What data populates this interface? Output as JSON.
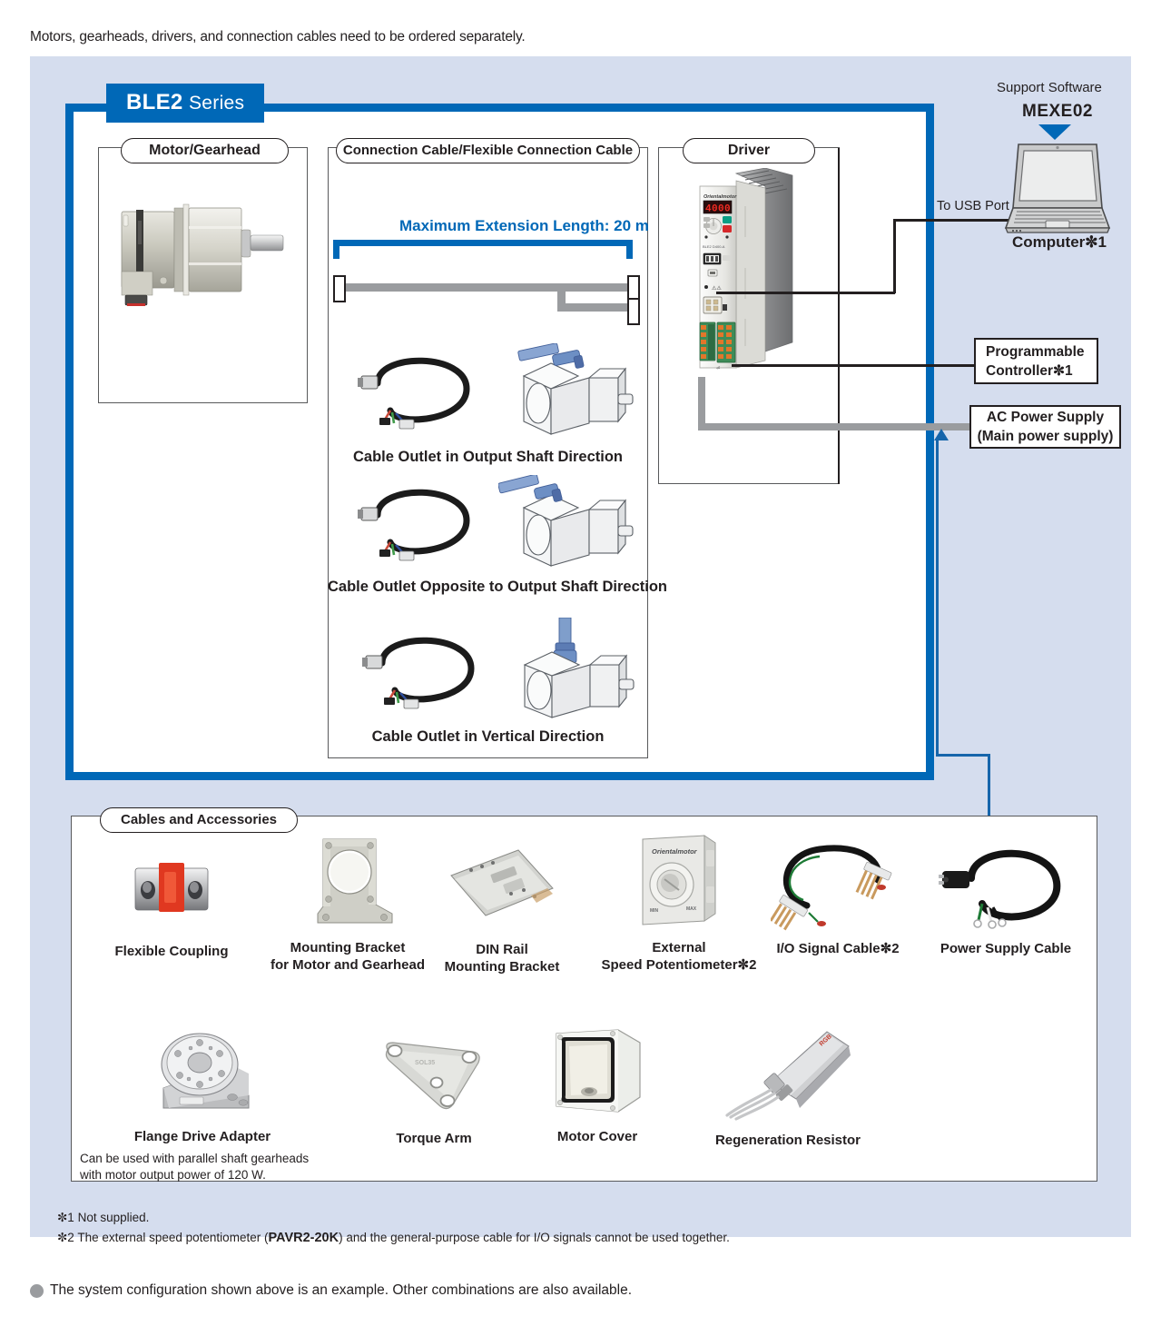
{
  "intro": "Motors, gearheads, drivers, and connection cables need to be ordered separately.",
  "series": {
    "name": "BLE2",
    "suffix": "Series"
  },
  "colors": {
    "brand_blue": "#0068B7",
    "panel_bg": "#D5DDEE",
    "cable_grey": "#9A9C9F",
    "text": "#231F20"
  },
  "sections": {
    "motor": {
      "title": "Motor/Gearhead"
    },
    "cable": {
      "title": "Connection Cable/Flexible Connection Cable",
      "max_extension": "Maximum Extension Length: 20 m",
      "variants": [
        {
          "caption": "Cable Outlet in Output Shaft Direction"
        },
        {
          "caption": "Cable Outlet Opposite to Output Shaft Direction"
        },
        {
          "caption": "Cable Outlet in Vertical Direction"
        }
      ]
    },
    "driver": {
      "title": "Driver",
      "display_value": "4000"
    }
  },
  "support": {
    "label": "Support Software",
    "product": "MEXE02",
    "computer": "Computer✼1",
    "usb_port": "To USB Port"
  },
  "side_boxes": {
    "plc_line1": "Programmable",
    "plc_line2": "Controller✼1",
    "ac_line1": "AC Power Supply",
    "ac_line2": "(Main power supply)"
  },
  "accessories": {
    "title": "Cables and Accessories",
    "row1": [
      {
        "label": "Flexible Coupling",
        "icon": "flexible-coupling"
      },
      {
        "label_line1": "Mounting Bracket",
        "label_line2": "for Motor and Gearhead",
        "icon": "mounting-bracket"
      },
      {
        "label_line1": "DIN Rail",
        "label_line2": "Mounting Bracket",
        "icon": "din-rail-bracket"
      },
      {
        "label_line1": "External",
        "label_line2": "Speed Potentiometer✼2",
        "icon": "speed-potentiometer"
      },
      {
        "label": "I/O Signal Cable✼2",
        "icon": "io-signal-cable"
      },
      {
        "label": "Power Supply Cable",
        "icon": "power-supply-cable"
      }
    ],
    "row2": [
      {
        "label": "Flange Drive Adapter",
        "note_line1": "Can be used with parallel shaft gearheads",
        "note_line2": "with motor output power of 120 W.",
        "icon": "flange-drive-adapter"
      },
      {
        "label": "Torque Arm",
        "icon": "torque-arm"
      },
      {
        "label": "Motor Cover",
        "icon": "motor-cover"
      },
      {
        "label": "Regeneration Resistor",
        "icon": "regeneration-resistor"
      }
    ]
  },
  "footnotes": {
    "fn1": "✼1 Not supplied.",
    "fn2_pre": "✼2 The external speed potentiometer (",
    "fn2_code": "PAVR2-20K",
    "fn2_post": ") and the general-purpose cable for I/O signals cannot be used together."
  },
  "bottom_note": "The system configuration shown above is an example. Other combinations are also available."
}
